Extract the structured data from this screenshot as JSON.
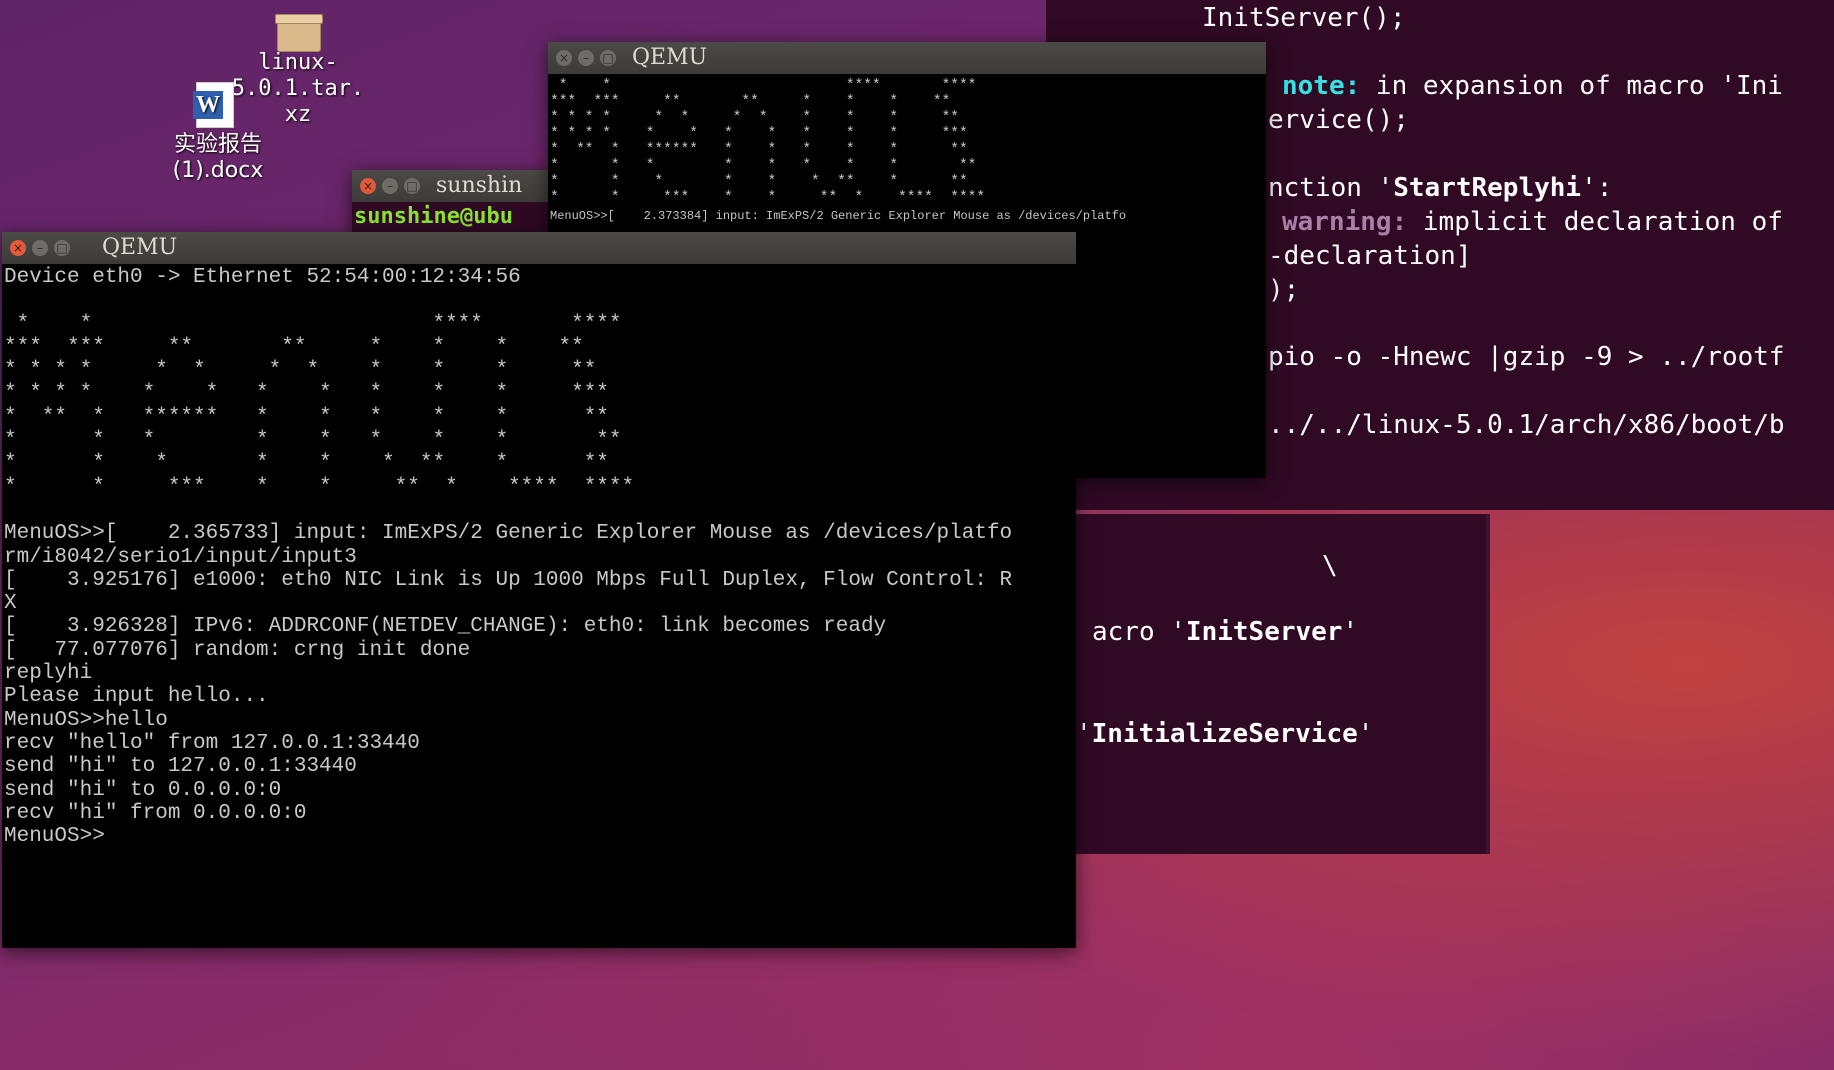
{
  "desktop": {
    "icons": [
      {
        "label": "linux-\n5.0.1.tar.\nxz",
        "icon": "archive-icon"
      },
      {
        "label": "实验报告\n(1).docx",
        "icon": "word-document-icon"
      }
    ]
  },
  "bg_terminal_top": {
    "lines": [
      "InitServer();",
      "",
      "note: in expansion of macro 'Ini",
      "ervice();",
      "",
      "nction 'StartReplyhi':",
      "warning: implicit declaration of",
      "-declaration]",
      ");",
      "",
      "pio -o -Hnewc |gzip -9 > ../rootf",
      "",
      "../../linux-5.0.1/arch/x86/boot/b"
    ],
    "note_label": "note:",
    "note_rest": " in expansion of macro 'Ini",
    "warning_label": "warning:",
    "warning_rest": " implicit declaration of",
    "func_prefix": "nction '",
    "func_name": "StartReplyhi",
    "func_suffix": "':"
  },
  "bg_terminal_bottom": {
    "backslash": "\\",
    "macro_prefix": "acro '",
    "macro_name": "InitServer",
    "macro_suffix": "'",
    "service_prefix": "'",
    "service_name": "InitializeService",
    "service_suffix": "'"
  },
  "gnome_terminal": {
    "title": "sunshin",
    "prompt": "sunshine@ubu"
  },
  "qemu_back": {
    "title": "QEMU",
    "ascii": [
      " *    *                           ****       ****",
      "***  ***     **       **     *    *    *    **",
      "* * * *     *  *     *  *    *    *    *     **",
      "* * * *    *    *   *    *   *    *    *     ***",
      "*  **  *   ******   *    *   *    *    *      **",
      "*      *   *        *    *   *    *    *       **",
      "*      *    *       *    *    *  **    *      **",
      "*      *     ***    *    *     **  *    ****  ****"
    ],
    "status_line": "MenuOS>>[    2.373384] input: ImExPS/2 Generic Explorer Mouse as /devices/platfo"
  },
  "qemu_front": {
    "title": "QEMU",
    "lines": [
      "Device eth0 -> Ethernet 52:54:00:12:34:56",
      "",
      " *    *                           ****       ****",
      "***  ***     **       **     *    *    *    **",
      "* * * *     *  *     *  *    *    *    *     **",
      "* * * *    *    *   *    *   *    *    *     ***",
      "*  **  *   ******   *    *   *    *    *      **",
      "*      *   *        *    *   *    *    *       **",
      "*      *    *       *    *    *  **    *      **",
      "*      *     ***    *    *     **  *    ****  ****",
      "",
      "MenuOS>>[    2.365733] input: ImExPS/2 Generic Explorer Mouse as /devices/platfo",
      "rm/i8042/serio1/input/input3",
      "[    3.925176] e1000: eth0 NIC Link is Up 1000 Mbps Full Duplex, Flow Control: R",
      "X",
      "[    3.926328] IPv6: ADDRCONF(NETDEV_CHANGE): eth0: link becomes ready",
      "[   77.077076] random: crng init done",
      "replyhi",
      "Please input hello...",
      "MenuOS>>hello",
      "recv \"hello\" from 127.0.0.1:33440",
      "send \"hi\" to 127.0.0.1:33440",
      "send \"hi\" to 0.0.0.0:0",
      "recv \"hi\" from 0.0.0.0:0",
      "MenuOS>>"
    ]
  }
}
